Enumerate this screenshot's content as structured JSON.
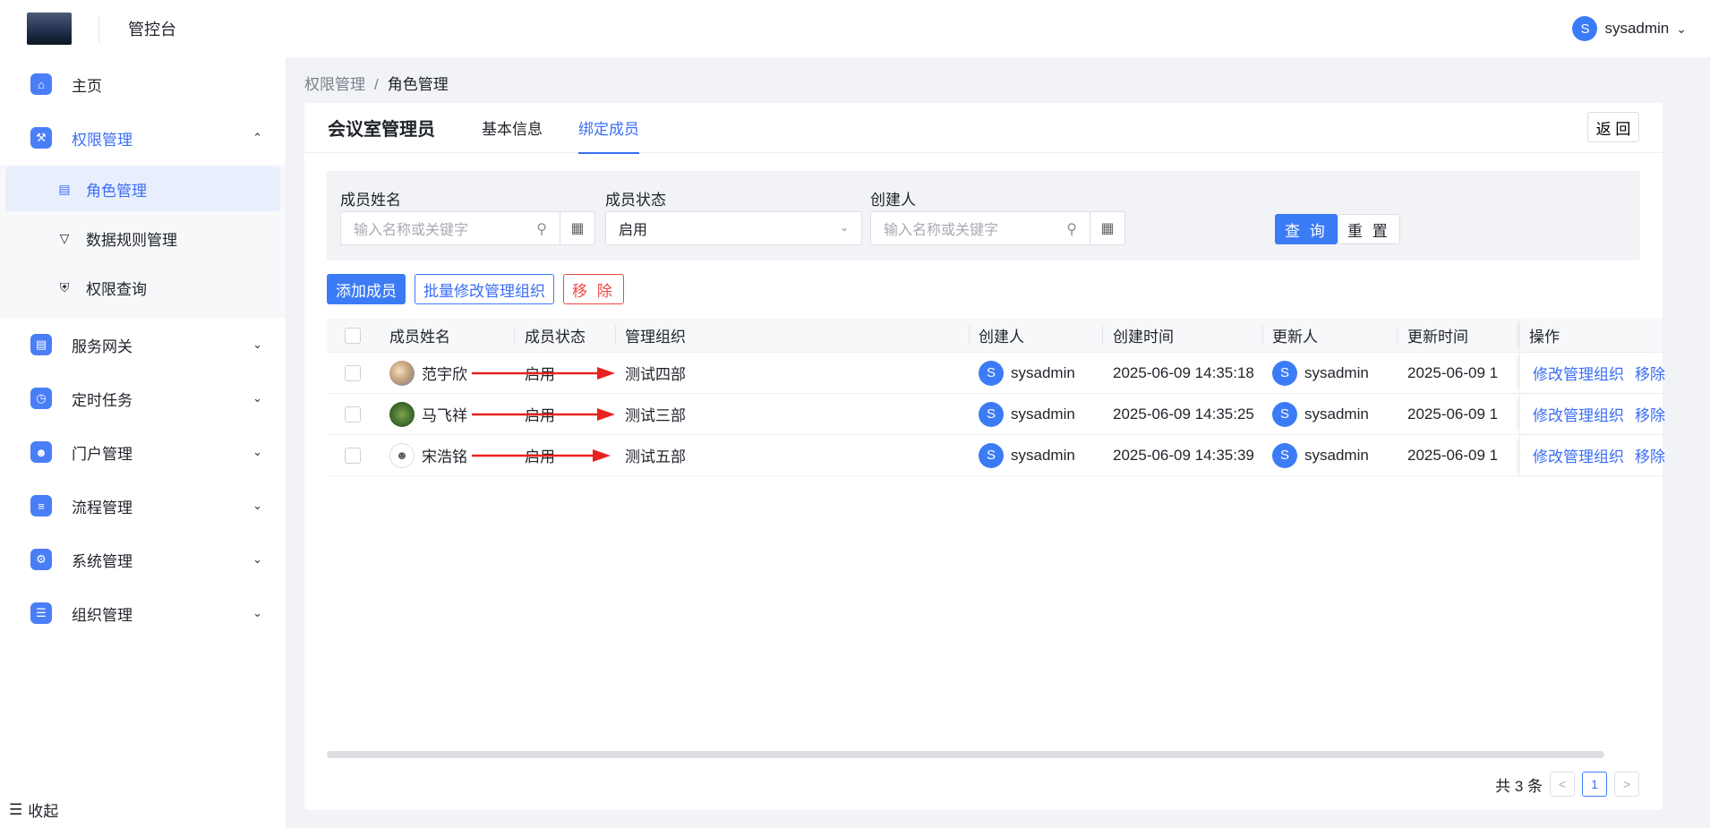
{
  "header": {
    "app_title": "管控台",
    "user_initial": "S",
    "user_name": "sysadmin"
  },
  "sidebar": {
    "items": [
      {
        "label": "主页",
        "icon": "home-icon"
      },
      {
        "label": "权限管理",
        "icon": "permission-icon",
        "open": true,
        "children": [
          {
            "label": "角色管理",
            "icon": "id-card-icon",
            "active": true
          },
          {
            "label": "数据规则管理",
            "icon": "filter-icon"
          },
          {
            "label": "权限查询",
            "icon": "shield-icon"
          }
        ]
      },
      {
        "label": "服务网关",
        "icon": "gateway-icon"
      },
      {
        "label": "定时任务",
        "icon": "clock-icon"
      },
      {
        "label": "门户管理",
        "icon": "portal-icon"
      },
      {
        "label": "流程管理",
        "icon": "flow-icon"
      },
      {
        "label": "系统管理",
        "icon": "settings-icon"
      },
      {
        "label": "组织管理",
        "icon": "org-icon"
      }
    ],
    "collapse_label": "收起"
  },
  "breadcrumb": {
    "parent": "权限管理",
    "sep": "/",
    "current": "角色管理"
  },
  "card": {
    "role_title": "会议室管理员",
    "tabs": [
      {
        "label": "基本信息"
      },
      {
        "label": "绑定成员",
        "active": true
      }
    ],
    "back_label": "返 回"
  },
  "filter": {
    "name_label": "成员姓名",
    "name_placeholder": "输入名称或关键字",
    "status_label": "成员状态",
    "status_value": "启用",
    "creator_label": "创建人",
    "creator_placeholder": "输入名称或关键字",
    "query_label": "查 询",
    "reset_label": "重 置"
  },
  "actions": {
    "add": "添加成员",
    "batch": "批量修改管理组织",
    "remove": "移 除"
  },
  "table": {
    "columns": [
      "成员姓名",
      "成员状态",
      "管理组织",
      "创建人",
      "创建时间",
      "更新人",
      "更新时间",
      "操作"
    ],
    "rows": [
      {
        "name": "范宇欣",
        "status": "启用",
        "org": "测试四部",
        "creator": "sysadmin",
        "created": "2025-06-09 14:35:18",
        "updater": "sysadmin",
        "updated": "2025-06-09 1"
      },
      {
        "name": "马飞祥",
        "status": "启用",
        "org": "测试三部",
        "creator": "sysadmin",
        "created": "2025-06-09 14:35:25",
        "updater": "sysadmin",
        "updated": "2025-06-09 1"
      },
      {
        "name": "宋浩铭",
        "status": "启用",
        "org": "测试五部",
        "creator": "sysadmin",
        "created": "2025-06-09 14:35:39",
        "updater": "sysadmin",
        "updated": "2025-06-09 1"
      }
    ],
    "op_edit": "修改管理组织",
    "op_remove": "移除",
    "avatar_initial": "S"
  },
  "pager": {
    "total_text": "共 3 条",
    "current_page": "1"
  },
  "colors": {
    "primary": "#3b7cf6",
    "danger": "#f04848",
    "annotation_arrow": "#e8231f"
  }
}
